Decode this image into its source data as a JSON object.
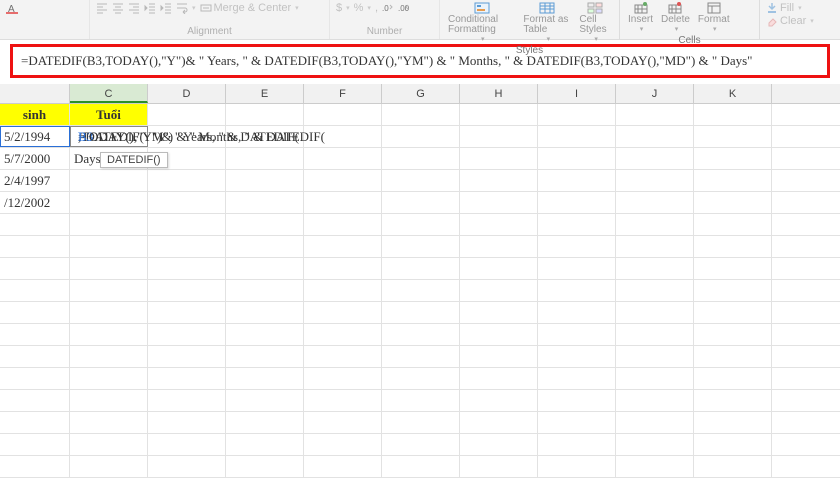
{
  "ribbon": {
    "font": {
      "label": ""
    },
    "alignment": {
      "label": "Alignment",
      "merge": "Merge & Center"
    },
    "number": {
      "label": "Number",
      "currency": "$",
      "percent": "%",
      "comma": ","
    },
    "styles": {
      "label": "Styles",
      "cond": "Conditional Formatting",
      "table": "Format as Table",
      "cell": "Cell Styles"
    },
    "cells": {
      "label": "Cells",
      "insert": "Insert",
      "delete": "Delete",
      "format": "Format"
    },
    "editing": {
      "fill": "Fill",
      "clear": "Clear"
    }
  },
  "formula": "=DATEDIF(B3,TODAY(),\"Y\")& \" Years, \" & DATEDIF(B3,TODAY(),\"YM\") & \" Months, \" & DATEDIF(B3,TODAY(),\"MD\") & \" Days\"",
  "columns": [
    "",
    "C",
    "D",
    "E",
    "F",
    "G",
    "H",
    "I",
    "J",
    "K"
  ],
  "headers": {
    "b": "sinh",
    "c": "Tuổi"
  },
  "data": {
    "b3": "5/2/1994",
    "b4": "5/7/2000",
    "b5": "2/4/1997",
    "b6": "/12/2002",
    "c3_prefix": "=DATEDIF(",
    "c3_ref1": "B3",
    "c3_mid1": ",TODAY(),\"Y\")& \" Years, \" & DATEDIF(",
    "c3_ref2": "B3",
    "c3_mid2": ",TODAY(),\"YM\") & \" Months, \" & DATEDIF(",
    "c3_ref3": "B",
    "c4": "Days\""
  },
  "tooltip": "DATEDIF()"
}
